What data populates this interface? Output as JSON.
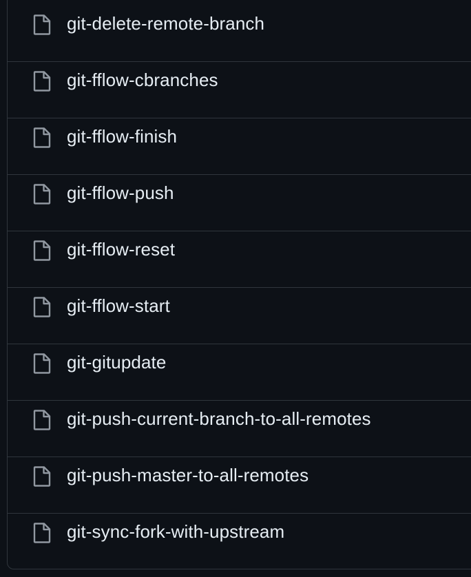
{
  "file_list": {
    "items": [
      {
        "name": "git-delete-remote-branch",
        "icon": "file-icon"
      },
      {
        "name": "git-fflow-cbranches",
        "icon": "file-icon"
      },
      {
        "name": "git-fflow-finish",
        "icon": "file-icon"
      },
      {
        "name": "git-fflow-push",
        "icon": "file-icon"
      },
      {
        "name": "git-fflow-reset",
        "icon": "file-icon"
      },
      {
        "name": "git-fflow-start",
        "icon": "file-icon"
      },
      {
        "name": "git-gitupdate",
        "icon": "file-icon"
      },
      {
        "name": "git-push-current-branch-to-all-remotes",
        "icon": "file-icon"
      },
      {
        "name": "git-push-master-to-all-remotes",
        "icon": "file-icon"
      },
      {
        "name": "git-sync-fork-with-upstream",
        "icon": "file-icon"
      }
    ]
  },
  "colors": {
    "background": "#0d1117",
    "border": "#30363d",
    "text": "#e6edf3",
    "icon": "#9198a1"
  }
}
